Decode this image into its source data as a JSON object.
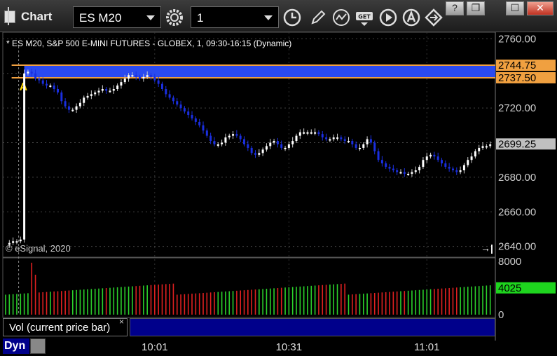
{
  "window": {
    "title": "Chart",
    "symbol": "ES M20",
    "interval": "1",
    "buttons": {
      "minimize": "?",
      "restore": "❐",
      "maximize": "☐",
      "close": "✕"
    }
  },
  "toolbar_icons": [
    "gear-icon",
    "clock-icon",
    "pencil-icon",
    "chart-wave-icon",
    "get-icon",
    "play-icon",
    "a-icon",
    "diamond-arrow-icon"
  ],
  "colors": {
    "background": "#000000",
    "up_bar": "#ffffff",
    "down_bar": "#1a2fe0",
    "zone": "#2a4af0",
    "zone_border": "#f0a040",
    "last_price_box": "#c0c0c0",
    "vol_up": "#2bd12b",
    "vol_down": "#e02020",
    "vol_value_box": "#1ed41e"
  },
  "chart": {
    "description": "* ES M20, S&P 500 E-MINI FUTURES - GLOBEX, 1, 09:30-16:15 (Dynamic)",
    "copyright": "© eSignal, 2020",
    "marker_label": "A",
    "vol_label": "Vol (current price bar)",
    "vol_close": "×",
    "dyn_label": "Dyn",
    "scroll_end_icon": "→|"
  },
  "chart_data": {
    "type": "candlestick",
    "price_axis": {
      "ylim": [
        2635,
        2763
      ],
      "ticks": [
        "2760.00",
        "2720.00",
        "2680.00",
        "2660.00",
        "2640.00"
      ]
    },
    "price_labels": {
      "zone_high": "2744.75",
      "zone_low": "2737.50",
      "last": "2699.25"
    },
    "volume_axis": {
      "ylim": [
        0,
        8000
      ],
      "ticks": [
        "8000",
        "0"
      ],
      "current": "4025"
    },
    "time_ticks": [
      "10:01",
      "10:31",
      "11:01"
    ],
    "price_path": [
      2641,
      2642,
      2643,
      2643,
      2644,
      2740,
      2741,
      2740,
      2737,
      2736,
      2734,
      2733,
      2733,
      2731,
      2729,
      2724,
      2721,
      2719,
      2719,
      2721,
      2723,
      2726,
      2727,
      2728,
      2729,
      2730,
      2731,
      2730,
      2730,
      2731,
      2733,
      2735,
      2737,
      2739,
      2739,
      2738,
      2737,
      2738,
      2739,
      2738,
      2736,
      2734,
      2731,
      2728,
      2726,
      2724,
      2722,
      2720,
      2718,
      2716,
      2714,
      2712,
      2710,
      2707,
      2704,
      2701,
      2699,
      2699,
      2700,
      2703,
      2704,
      2705,
      2704,
      2702,
      2699,
      2697,
      2694,
      2693,
      2694,
      2696,
      2698,
      2700,
      2701,
      2699,
      2697,
      2697,
      2699,
      2701,
      2704,
      2706,
      2706,
      2706,
      2706,
      2706,
      2705,
      2703,
      2702,
      2702,
      2703,
      2703,
      2702,
      2701,
      2701,
      2699,
      2697,
      2697,
      2699,
      2702,
      2700,
      2695,
      2690,
      2688,
      2686,
      2685,
      2684,
      2683,
      2683,
      2682,
      2682,
      2683,
      2684,
      2686,
      2690,
      2692,
      2693,
      2692,
      2690,
      2688,
      2686,
      2685,
      2684,
      2683,
      2684,
      2687,
      2690,
      2692,
      2695,
      2697,
      2698,
      2698,
      2699
    ]
  }
}
